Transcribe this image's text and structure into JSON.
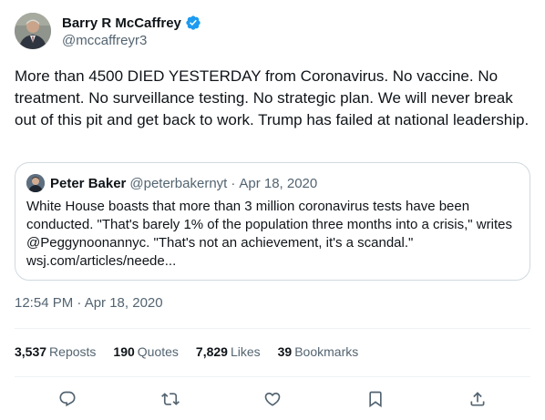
{
  "author": {
    "display_name": "Barry R McCaffrey",
    "handle": "@mccaffreyr3",
    "verified": true
  },
  "tweet": {
    "text": "More than 4500 DIED YESTERDAY from Coronavirus. No vaccine. No treatment. No surveillance testing. No strategic plan. We will never break out of this pit and get back to work. Trump has failed at national leadership.",
    "timestamp": "12:54 PM · Apr 18, 2020"
  },
  "quoted_tweet": {
    "display_name": "Peter Baker",
    "handle": "@peterbakernyt",
    "separator": "·",
    "date": "Apr 18, 2020",
    "text": "White House boasts that more than 3 million coronavirus tests have been conducted. \"That's barely 1% of the population three months into a crisis,\" writes @Peggynoonannyc. \"That's not an achievement, it's a scandal.\" wsj.com/articles/neede..."
  },
  "stats": {
    "reposts": {
      "count": "3,537",
      "label": "Reposts"
    },
    "quotes": {
      "count": "190",
      "label": "Quotes"
    },
    "likes": {
      "count": "7,829",
      "label": "Likes"
    },
    "bookmarks": {
      "count": "39",
      "label": "Bookmarks"
    }
  },
  "actions": [
    "reply-icon",
    "repost-icon",
    "like-icon",
    "bookmark-icon",
    "share-icon"
  ],
  "colors": {
    "text_primary": "#0f1419",
    "text_secondary": "#536471",
    "border": "#cfd9de",
    "verified": "#1d9bf0"
  }
}
